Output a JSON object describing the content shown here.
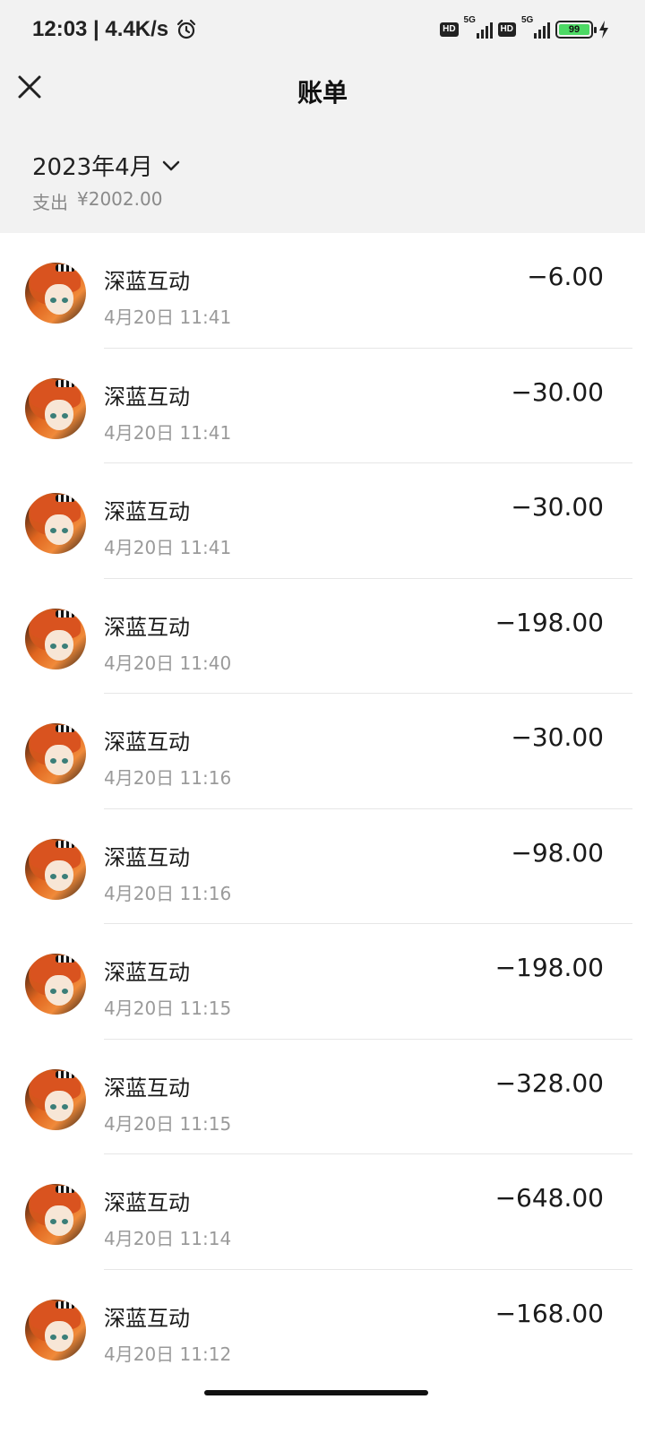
{
  "status_bar": {
    "time_speed": "12:03 | 4.4K/s",
    "hd1": "HD",
    "net1": "5G",
    "hd2": "HD",
    "net2": "5G",
    "battery": "99"
  },
  "header": {
    "title": "账单"
  },
  "summary": {
    "month": "2023年4月",
    "expense_label": "支出",
    "expense_value": "¥2002.00"
  },
  "transactions": [
    {
      "merchant": "深蓝互动",
      "time": "4月20日 11:41",
      "amount": "−6.00"
    },
    {
      "merchant": "深蓝互动",
      "time": "4月20日 11:41",
      "amount": "−30.00"
    },
    {
      "merchant": "深蓝互动",
      "time": "4月20日 11:41",
      "amount": "−30.00"
    },
    {
      "merchant": "深蓝互动",
      "time": "4月20日 11:40",
      "amount": "−198.00"
    },
    {
      "merchant": "深蓝互动",
      "time": "4月20日 11:16",
      "amount": "−30.00"
    },
    {
      "merchant": "深蓝互动",
      "time": "4月20日 11:16",
      "amount": "−98.00"
    },
    {
      "merchant": "深蓝互动",
      "time": "4月20日 11:15",
      "amount": "−198.00"
    },
    {
      "merchant": "深蓝互动",
      "time": "4月20日 11:15",
      "amount": "−328.00"
    },
    {
      "merchant": "深蓝互动",
      "time": "4月20日 11:14",
      "amount": "−648.00"
    },
    {
      "merchant": "深蓝互动",
      "time": "4月20日 11:12",
      "amount": "−168.00"
    }
  ]
}
